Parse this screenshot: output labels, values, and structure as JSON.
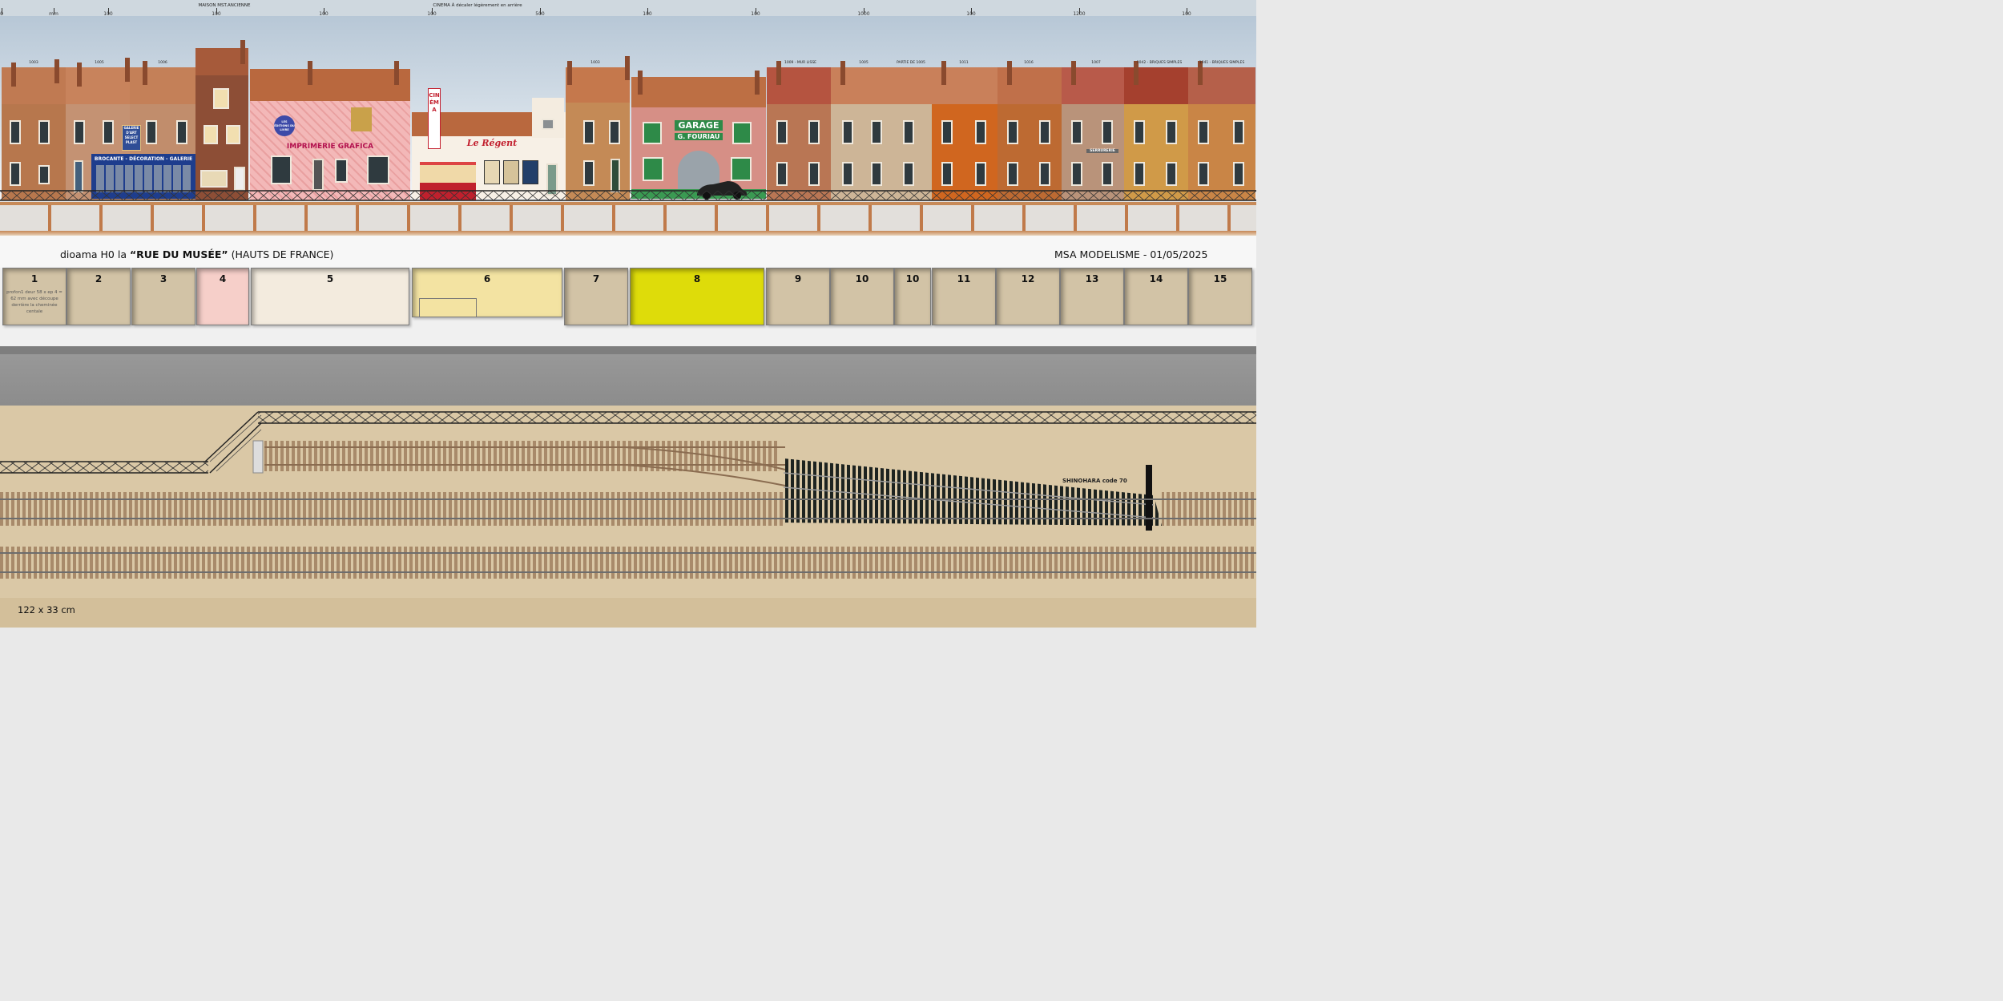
{
  "ruler": {
    "ticks": [
      {
        "label": "0"
      },
      {
        "label": "mm"
      },
      {
        "label": "100"
      },
      {
        "label": "100"
      },
      {
        "label": "100"
      },
      {
        "label": "100"
      },
      {
        "label": "500"
      },
      {
        "label": "100"
      },
      {
        "label": "100"
      },
      {
        "label": "1000"
      },
      {
        "label": "100"
      },
      {
        "label": "1200"
      },
      {
        "label": "100"
      }
    ],
    "notes": {
      "maison": "MAISON MST.ANCIENNE",
      "cinema": "CINEMA À décaler légèrement en arrière"
    }
  },
  "facades": {
    "codes": [
      "1003",
      "1005",
      "1006",
      "1003",
      "1009 - MUR LISSE",
      "1005",
      "PARTIE DE 1005",
      "1011",
      "1016",
      "1007",
      "1042 - BRIQUES SIMPLES",
      "1041 - BRIQUES SIMPLES"
    ],
    "signs": {
      "galerie": "GALERIE D'ART SELECT PLAST",
      "brocante": "BROCANTE - DÉCORATION - GALERIE",
      "imprimerie": "IMPRIMERIE GRAFICA",
      "cinema_vertical": "CINÉMA",
      "cinema_name": "Le Régent",
      "garage": "GARAGE",
      "garage_owner": "G. FOURIAU",
      "serrurerie": "SERRURERIE",
      "badge": "LES ÉDITIONS DU LIVRE"
    }
  },
  "layout_caption": {
    "title_prefix": "dioama H0 la ",
    "title_bold": "“RUE DU MUSÉE”",
    "title_suffix": "  (HAUTS DE FRANCE)",
    "author_date": "MSA MODELISME - 01/05/2025"
  },
  "boxes": [
    {
      "num": "1",
      "note": "profon1 deur 58 x ep 4 = 62 mm avec découpe derrière la cheminée centale",
      "color": "#d2c3a6"
    },
    {
      "num": "2",
      "note": "",
      "color": "#d2c3a6"
    },
    {
      "num": "3",
      "note": "",
      "color": "#d2c3a6"
    },
    {
      "num": "4",
      "note": "",
      "color": "#f6cfc9"
    },
    {
      "num": "5",
      "note": "",
      "color": "#f3ebde"
    },
    {
      "num": "6",
      "note": "",
      "color": "#f3e3a2"
    },
    {
      "num": "7",
      "note": "",
      "color": "#d2c3a6"
    },
    {
      "num": "8",
      "note": "",
      "color": "#dedc0a"
    },
    {
      "num": "9",
      "note": "",
      "color": "#d2c3a6"
    },
    {
      "num": "10",
      "note": "",
      "color": "#d2c3a6"
    },
    {
      "num": "10",
      "note": "",
      "color": "#d2c3a6"
    },
    {
      "num": "11",
      "note": "",
      "color": "#d2c3a6"
    },
    {
      "num": "12",
      "note": "",
      "color": "#d2c3a6"
    },
    {
      "num": "13",
      "note": "",
      "color": "#d2c3a6"
    },
    {
      "num": "14",
      "note": "",
      "color": "#d2c3a6"
    },
    {
      "num": "15",
      "note": "",
      "color": "#d2c3a6"
    }
  ],
  "track": {
    "turnout_label": "SHINOHARA code 70"
  },
  "dimensions": "122 x 33 cm",
  "colors": {
    "brick": "#b46a3e",
    "roof": "#c0704a",
    "ground": "#dac8a6",
    "sleeper": "#a88a6a",
    "rail": "#6d6d6d"
  }
}
